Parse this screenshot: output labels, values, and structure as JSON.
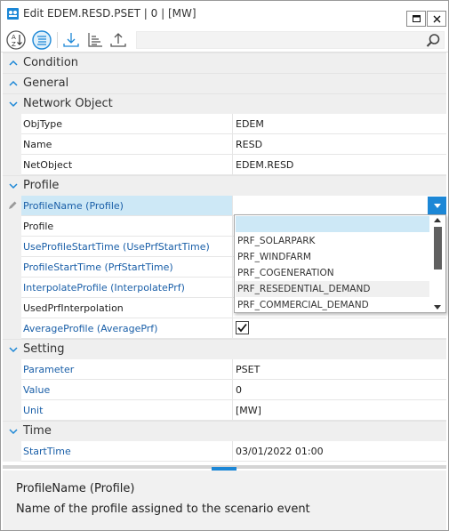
{
  "window": {
    "title": "Edit EDEM.RESD.PSET | 0 | [MW]",
    "restore_glyph": "▫",
    "close_glyph": "✕"
  },
  "toolbar": {
    "buttons": [
      "sort-alphabetical-icon",
      "categorized-icon",
      "download-icon",
      "sort-list-icon",
      "upload-icon"
    ],
    "search": {
      "value": "",
      "placeholder": ""
    }
  },
  "categories": {
    "condition": "Condition",
    "general": "General",
    "network_object": "Network Object",
    "profile": "Profile",
    "setting": "Setting",
    "time": "Time"
  },
  "network_object_rows": [
    {
      "name": "ObjType",
      "value": "EDEM"
    },
    {
      "name": "Name",
      "value": "RESD"
    },
    {
      "name": "NetObject",
      "value": "EDEM.RESD"
    }
  ],
  "profile_rows": [
    {
      "name": "ProfileName (Profile)",
      "value": ""
    },
    {
      "name": "Profile",
      "value": ""
    },
    {
      "name": "UseProfileStartTime (UsePrfStartTime)",
      "value": ""
    },
    {
      "name": "ProfileStartTime (PrfStartTime)",
      "value": ""
    },
    {
      "name": "InterpolateProfile (InterpolatePrf)",
      "value": ""
    },
    {
      "name": "UsedPrfInterpolation",
      "value": ""
    },
    {
      "name": "AverageProfile (AveragePrf)",
      "value": "",
      "checked": true
    }
  ],
  "setting_rows": [
    {
      "name": "Parameter",
      "value": "PSET"
    },
    {
      "name": "Value",
      "value": "0"
    },
    {
      "name": "Unit",
      "value": "[MW]"
    }
  ],
  "time_rows": [
    {
      "name": "StartTime",
      "value": "03/01/2022 01:00"
    }
  ],
  "dropdown": {
    "options": [
      "",
      "PRF_SOLARPARK",
      "PRF_WINDFARM",
      "PRF_COGENERATION",
      "PRF_RESEDENTIAL_DEMAND",
      "PRF_COMMERCIAL_DEMAND"
    ],
    "selected_index": 0,
    "hover_index": 4
  },
  "description": {
    "title": "ProfileName (Profile)",
    "text": "Name of the profile assigned to the scenario event"
  },
  "colors": {
    "accent": "#1c87d6",
    "selection": "#cde8f6",
    "category_bg": "#efefef",
    "link_text": "#1a5fa8"
  }
}
